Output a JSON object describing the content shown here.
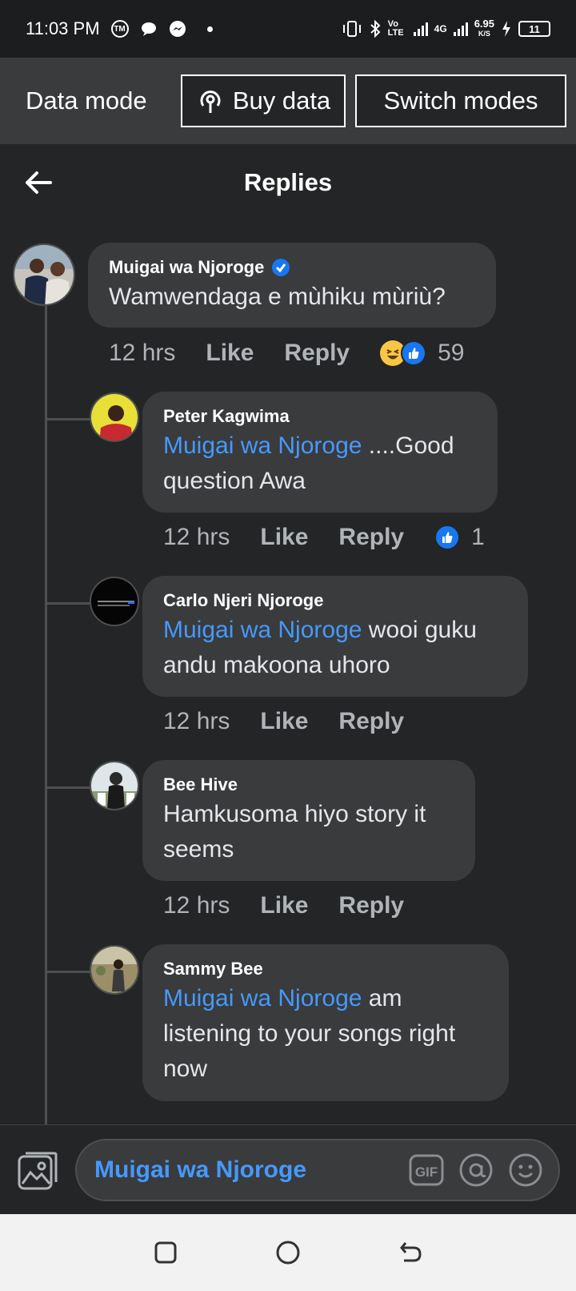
{
  "status_bar": {
    "time": "11:03 PM",
    "speed": "6.95",
    "speed_unit": "K/S",
    "network": "4G",
    "volte": "Vo LTE",
    "battery": "11"
  },
  "data_mode": {
    "label": "Data mode",
    "buy_data": "Buy data",
    "switch_modes": "Switch modes"
  },
  "header": {
    "title": "Replies"
  },
  "comments": [
    {
      "author": "Muigai wa Njoroge",
      "verified": true,
      "mention": "",
      "text": "Wamwendaga e mùhiku mùriù?",
      "time": "12 hrs",
      "like": "Like",
      "reply": "Reply",
      "reaction_count": "59"
    },
    {
      "author": "Peter Kagwima",
      "mention": "Muigai wa Njoroge",
      "text": " ....Good question Awa",
      "time": "12 hrs",
      "like": "Like",
      "reply": "Reply",
      "reaction_count": "1"
    },
    {
      "author": "Carlo Njeri Njoroge",
      "mention": "Muigai wa Njoroge",
      "text": " wooi guku andu makoona uhoro",
      "time": "12 hrs",
      "like": "Like",
      "reply": "Reply"
    },
    {
      "author": "Bee Hive",
      "mention": "",
      "text": "Hamkusoma hiyo story it seems",
      "time": "12 hrs",
      "like": "Like",
      "reply": "Reply"
    },
    {
      "author": "Sammy Bee",
      "mention": "Muigai wa Njoroge",
      "text": " am listening to your songs right now"
    }
  ],
  "composer": {
    "mention_value": "Muigai wa Njoroge"
  },
  "colors": {
    "accent": "#4599ff",
    "bubble": "#3a3b3c",
    "background": "#242526"
  }
}
